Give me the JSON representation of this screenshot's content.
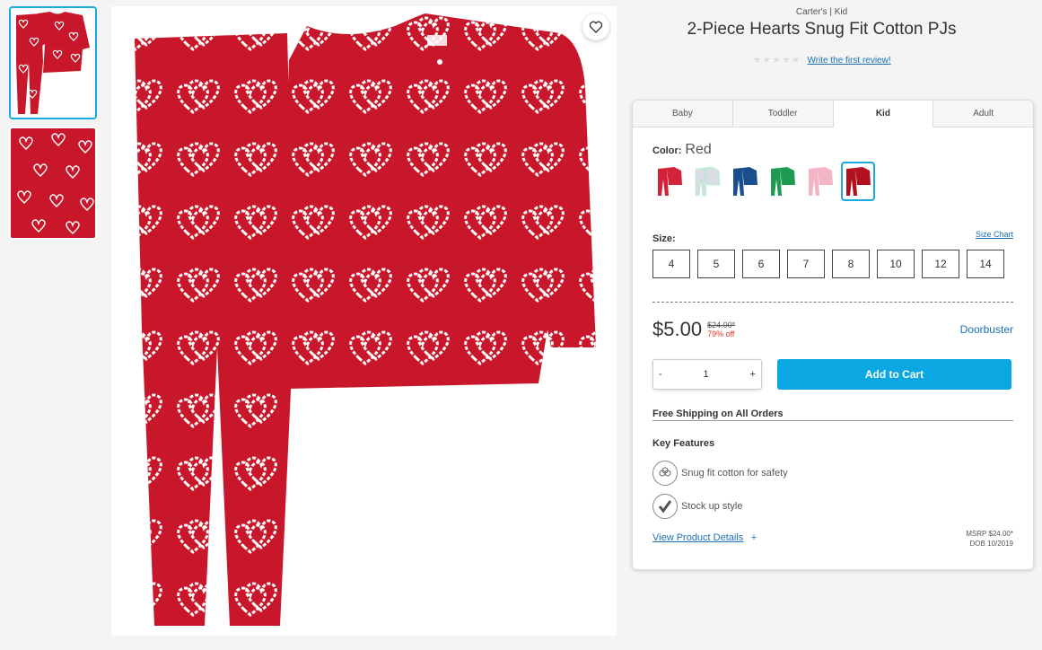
{
  "thumbnails": [
    {
      "name": "outfit view"
    },
    {
      "name": "fabric detail"
    }
  ],
  "product": {
    "brand_line": "Carter's | Kid",
    "title": "2-Piece Hearts Snug Fit Cotton PJs",
    "review_link": "Write the first review!",
    "rating_stars": "★★★★★"
  },
  "tabs": [
    {
      "label": "Baby"
    },
    {
      "label": "Toddler"
    },
    {
      "label": "Kid",
      "active": true
    },
    {
      "label": "Adult"
    }
  ],
  "color": {
    "label": "Color:",
    "value": "Red",
    "swatches": [
      "#d2233a",
      "#d8dde3",
      "#1a4f8e",
      "#1f9a52",
      "#f3b5c4",
      "#b3101f"
    ],
    "selected_index": 5
  },
  "size": {
    "label": "Size:",
    "chart_link": "Size Chart",
    "options": [
      "4",
      "5",
      "6",
      "7",
      "8",
      "10",
      "12",
      "14"
    ]
  },
  "pricing": {
    "price": "$5.00",
    "original": "$24.00*",
    "discount": "79% off",
    "badge": "Doorbuster"
  },
  "cart": {
    "minus": "-",
    "qty": "1",
    "plus": "+",
    "add_label": "Add to Cart"
  },
  "shipping": "Free Shipping on All Orders",
  "features": {
    "title": "Key Features",
    "items": [
      {
        "text": "Snug fit cotton for safety",
        "icon": "cotton-icon"
      },
      {
        "text": "Stock up style",
        "icon": "checkmark-icon"
      }
    ]
  },
  "footer": {
    "details_link": "View Product Details",
    "details_plus": "+",
    "msrp": "MSRP $24.00*",
    "dob": "DOB 10/2019"
  },
  "colors": {
    "accent": "#0aa7e3",
    "link": "#1a6fb8",
    "pajama_red": "#c8172a",
    "discount_red": "#dd3322"
  }
}
